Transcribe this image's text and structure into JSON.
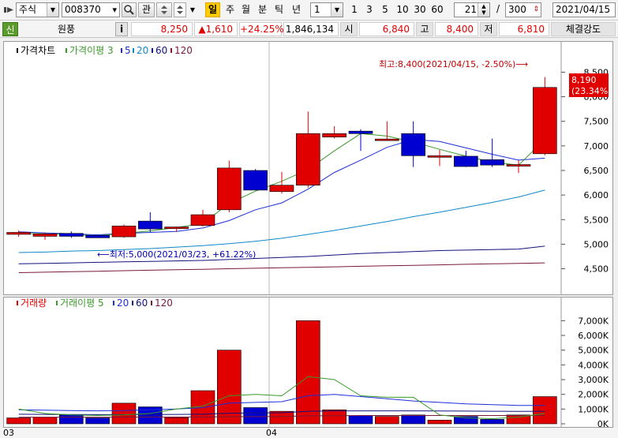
{
  "toolbar": {
    "menu_icon": "list-arrow-icon",
    "market": "주식",
    "code": "008370",
    "code_dropdown": "▾",
    "search_icon": "magnifier-icon",
    "watch_label": "관",
    "scroll_icon": "scroll-arrows-icon",
    "periods": [
      "일",
      "주",
      "월",
      "분",
      "틱",
      "년"
    ],
    "active_period": "일",
    "interval_value": "1",
    "intervals": [
      "1",
      "3",
      "5",
      "10",
      "30",
      "60"
    ],
    "count_value": "21",
    "count_sep": "/",
    "count_total": "300",
    "date_value": "2021/04/15"
  },
  "quote": {
    "tag": "신",
    "name": "원풍",
    "info_icon": "i",
    "price": "8,250",
    "change": "▲1,610",
    "change_pct": "+24.25%",
    "volume": "1,846,134",
    "open_label": "시",
    "open_value": "6,840",
    "high_label": "고",
    "high_value": "8,400",
    "low_label": "저",
    "low_value": "6,810",
    "strength_label": "체결강도"
  },
  "colors": {
    "up": "#e00000",
    "down": "#0000d0",
    "ma3": "#3a9a2a",
    "ma5": "#1c2fd8",
    "ma20": "#1088c8",
    "ma60": "#12127e",
    "ma120": "#7a1a3a",
    "accent": "#ffcc00"
  },
  "price_legend": [
    {
      "text": "가격차트",
      "color": "#000000"
    },
    {
      "text": "가격이평 3",
      "color": "#3a9a2a"
    },
    {
      "text": "5",
      "color": "#1c2fd8"
    },
    {
      "text": "20",
      "color": "#1088c8"
    },
    {
      "text": "60",
      "color": "#12127e"
    },
    {
      "text": "120",
      "color": "#7a1a3a"
    }
  ],
  "volume_legend": [
    {
      "text": "거래량",
      "color": "#e00000"
    },
    {
      "text": "거래이평 5",
      "color": "#3a9a2a"
    },
    {
      "text": "20",
      "color": "#1c2fd8"
    },
    {
      "text": "60",
      "color": "#12127e"
    },
    {
      "text": "120",
      "color": "#7a1a3a"
    }
  ],
  "annotations": {
    "high": "최고:8,400(2021/04/15, -2.50%)⟶",
    "low": "⟵최저:5,000(2021/03/23, +61.22%)",
    "last_price": "8,190",
    "last_pct": "(23.34%)"
  },
  "chart_data": {
    "type": "candlestick",
    "price_axis": {
      "ticks": [
        "8,500",
        "8,000",
        "7,500",
        "7,000",
        "6,500",
        "6,000",
        "5,500",
        "5,000",
        "4,500"
      ],
      "range": [
        4300,
        8700
      ]
    },
    "volume_axis": {
      "ticks": [
        "7,000K",
        "6,000K",
        "5,000K",
        "4,000K",
        "3,000K",
        "2,000K",
        "1,000K",
        "0K"
      ],
      "range": [
        0,
        7500
      ]
    },
    "x_labels": [
      "03",
      "04"
    ],
    "candles": [
      {
        "open": 5200,
        "high": 5280,
        "low": 5150,
        "close": 5240,
        "volume": 400
      },
      {
        "open": 5160,
        "high": 5240,
        "low": 5090,
        "close": 5210,
        "volume": 450
      },
      {
        "open": 5220,
        "high": 5260,
        "low": 5130,
        "close": 5160,
        "volume": 600
      },
      {
        "open": 5180,
        "high": 5200,
        "low": 5130,
        "close": 5130,
        "volume": 400
      },
      {
        "open": 5150,
        "high": 5400,
        "low": 5130,
        "close": 5370,
        "volume": 1400
      },
      {
        "open": 5470,
        "high": 5650,
        "low": 5250,
        "close": 5310,
        "volume": 1150
      },
      {
        "open": 5320,
        "high": 5360,
        "low": 5250,
        "close": 5350,
        "volume": 420
      },
      {
        "open": 5380,
        "high": 5700,
        "low": 5360,
        "close": 5600,
        "volume": 2250
      },
      {
        "open": 5700,
        "high": 6700,
        "low": 5650,
        "close": 6550,
        "volume": 5000
      },
      {
        "open": 6500,
        "high": 6530,
        "low": 6100,
        "close": 6100,
        "volume": 1100
      },
      {
        "open": 6070,
        "high": 6470,
        "low": 6030,
        "close": 6200,
        "volume": 850
      },
      {
        "open": 6200,
        "high": 7700,
        "low": 6150,
        "close": 7250,
        "volume": 7000
      },
      {
        "open": 7180,
        "high": 7400,
        "low": 7150,
        "close": 7250,
        "volume": 950
      },
      {
        "open": 7300,
        "high": 7340,
        "low": 6900,
        "close": 7250,
        "volume": 550
      },
      {
        "open": 7140,
        "high": 7500,
        "low": 7130,
        "close": 7140,
        "volume": 500
      },
      {
        "open": 7250,
        "high": 7500,
        "low": 6570,
        "close": 6800,
        "volume": 600
      },
      {
        "open": 6800,
        "high": 6920,
        "low": 6590,
        "close": 6800,
        "volume": 250
      },
      {
        "open": 6790,
        "high": 6900,
        "low": 6570,
        "close": 6580,
        "volume": 500
      },
      {
        "open": 6720,
        "high": 7150,
        "low": 6570,
        "close": 6610,
        "volume": 300
      },
      {
        "open": 6590,
        "high": 6700,
        "low": 6450,
        "close": 6620,
        "volume": 600
      },
      {
        "open": 6840,
        "high": 8400,
        "low": 6810,
        "close": 8190,
        "volume": 1846
      }
    ],
    "ma3": [
      5220,
      5210,
      5200,
      5170,
      5220,
      5270,
      5340,
      5420,
      5830,
      6080,
      6280,
      6520,
      6900,
      7250,
      7200,
      7080,
      6930,
      6790,
      6670,
      6610,
      7130
    ],
    "ma5": [
      5250,
      5230,
      5210,
      5190,
      5220,
      5240,
      5260,
      5330,
      5480,
      5700,
      5840,
      6120,
      6460,
      6710,
      6970,
      7130,
      7090,
      6960,
      6830,
      6710,
      6750
    ],
    "ma20": [
      4830,
      4840,
      4860,
      4870,
      4890,
      4910,
      4940,
      4970,
      5010,
      5060,
      5120,
      5200,
      5280,
      5370,
      5460,
      5560,
      5650,
      5750,
      5850,
      5960,
      6100
    ],
    "ma60": [
      4600,
      4610,
      4620,
      4630,
      4640,
      4650,
      4660,
      4670,
      4690,
      4710,
      4730,
      4750,
      4780,
      4810,
      4830,
      4850,
      4870,
      4880,
      4890,
      4900,
      4960
    ],
    "ma120": [
      4420,
      4430,
      4440,
      4450,
      4460,
      4470,
      4480,
      4490,
      4500,
      4510,
      4520,
      4530,
      4540,
      4550,
      4560,
      4570,
      4580,
      4590,
      4600,
      4610,
      4620
    ],
    "vol_ma5": [
      1000,
      700,
      600,
      560,
      600,
      700,
      1000,
      1200,
      1900,
      2000,
      1900,
      3200,
      3000,
      1900,
      1800,
      1800,
      600,
      400,
      350,
      450,
      700
    ],
    "vol_ma20": [
      950,
      920,
      900,
      880,
      900,
      950,
      1000,
      1100,
      1400,
      1450,
      1500,
      1900,
      2000,
      1850,
      1700,
      1550,
      1450,
      1350,
      1300,
      1250,
      1250
    ],
    "vol_ma60": [
      650,
      640,
      630,
      620,
      620,
      630,
      640,
      650,
      720,
      740,
      750,
      850,
      870,
      880,
      880,
      880,
      870,
      860,
      850,
      840,
      850
    ],
    "vol_ma120": [
      450,
      450,
      450,
      450,
      450,
      460,
      460,
      460,
      480,
      490,
      500,
      540,
      550,
      560,
      560,
      560,
      560,
      560,
      560,
      560,
      570
    ]
  }
}
